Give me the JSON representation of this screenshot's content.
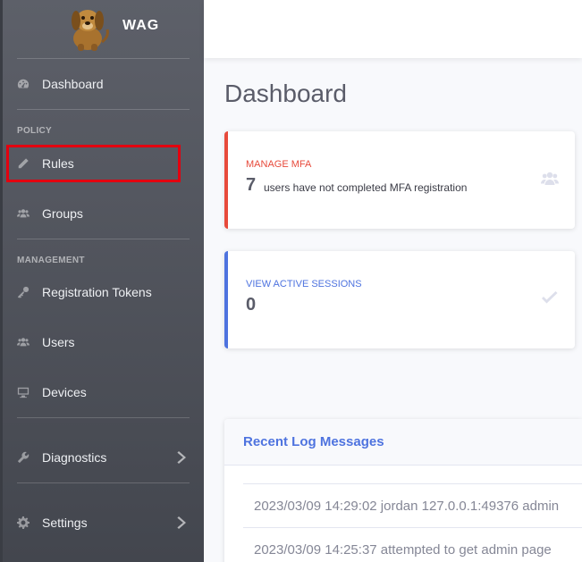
{
  "brand": {
    "name": "WAG"
  },
  "sidebar": {
    "items": [
      {
        "label": "Dashboard",
        "icon": "tachometer-icon"
      },
      {
        "label": "Rules",
        "icon": "pencil-icon"
      },
      {
        "label": "Groups",
        "icon": "users-icon"
      },
      {
        "label": "Registration Tokens",
        "icon": "key-icon"
      },
      {
        "label": "Users",
        "icon": "users-icon"
      },
      {
        "label": "Devices",
        "icon": "desktop-icon"
      },
      {
        "label": "Diagnostics",
        "icon": "wrench-icon"
      },
      {
        "label": "Settings",
        "icon": "gear-icon"
      }
    ],
    "sections": {
      "policy": "POLICY",
      "management": "MANAGEMENT"
    }
  },
  "page": {
    "title": "Dashboard"
  },
  "cards": {
    "mfa": {
      "label": "MANAGE MFA",
      "value": "7",
      "sub": "users have not completed MFA registration",
      "icon": "users-icon",
      "accent": "#e74a3b"
    },
    "sessions": {
      "label": "VIEW ACTIVE SESSIONS",
      "value": "0",
      "icon": "check-icon",
      "accent": "#4e73df"
    }
  },
  "logs": {
    "title": "Recent Log Messages",
    "rows": [
      "2023/03/09 14:29:02 jordan 127.0.0.1:49376 admin",
      "2023/03/09 14:25:37 attempted to get admin page"
    ]
  },
  "highlight": {
    "color": "#e3000f",
    "target": "Rules"
  }
}
